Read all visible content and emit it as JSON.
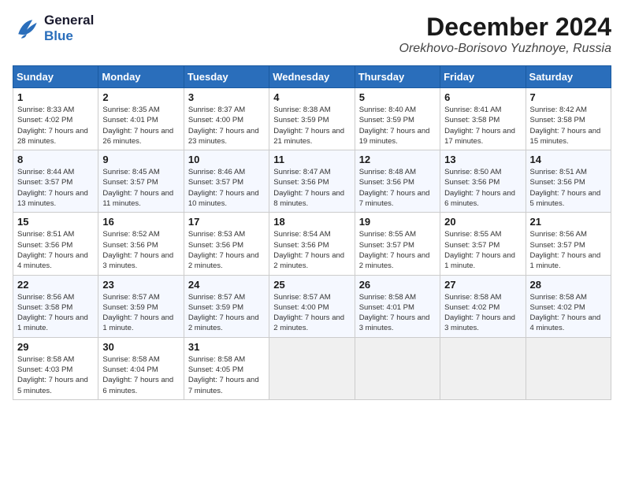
{
  "header": {
    "logo_line1": "General",
    "logo_line2": "Blue",
    "month": "December 2024",
    "location": "Orekhovo-Borisovo Yuzhnoye, Russia"
  },
  "days_of_week": [
    "Sunday",
    "Monday",
    "Tuesday",
    "Wednesday",
    "Thursday",
    "Friday",
    "Saturday"
  ],
  "weeks": [
    [
      {
        "day": 1,
        "sunrise": "8:33 AM",
        "sunset": "4:02 PM",
        "daylight": "7 hours and 28 minutes."
      },
      {
        "day": 2,
        "sunrise": "8:35 AM",
        "sunset": "4:01 PM",
        "daylight": "7 hours and 26 minutes."
      },
      {
        "day": 3,
        "sunrise": "8:37 AM",
        "sunset": "4:00 PM",
        "daylight": "7 hours and 23 minutes."
      },
      {
        "day": 4,
        "sunrise": "8:38 AM",
        "sunset": "3:59 PM",
        "daylight": "7 hours and 21 minutes."
      },
      {
        "day": 5,
        "sunrise": "8:40 AM",
        "sunset": "3:59 PM",
        "daylight": "7 hours and 19 minutes."
      },
      {
        "day": 6,
        "sunrise": "8:41 AM",
        "sunset": "3:58 PM",
        "daylight": "7 hours and 17 minutes."
      },
      {
        "day": 7,
        "sunrise": "8:42 AM",
        "sunset": "3:58 PM",
        "daylight": "7 hours and 15 minutes."
      }
    ],
    [
      {
        "day": 8,
        "sunrise": "8:44 AM",
        "sunset": "3:57 PM",
        "daylight": "7 hours and 13 minutes."
      },
      {
        "day": 9,
        "sunrise": "8:45 AM",
        "sunset": "3:57 PM",
        "daylight": "7 hours and 11 minutes."
      },
      {
        "day": 10,
        "sunrise": "8:46 AM",
        "sunset": "3:57 PM",
        "daylight": "7 hours and 10 minutes."
      },
      {
        "day": 11,
        "sunrise": "8:47 AM",
        "sunset": "3:56 PM",
        "daylight": "7 hours and 8 minutes."
      },
      {
        "day": 12,
        "sunrise": "8:48 AM",
        "sunset": "3:56 PM",
        "daylight": "7 hours and 7 minutes."
      },
      {
        "day": 13,
        "sunrise": "8:50 AM",
        "sunset": "3:56 PM",
        "daylight": "7 hours and 6 minutes."
      },
      {
        "day": 14,
        "sunrise": "8:51 AM",
        "sunset": "3:56 PM",
        "daylight": "7 hours and 5 minutes."
      }
    ],
    [
      {
        "day": 15,
        "sunrise": "8:51 AM",
        "sunset": "3:56 PM",
        "daylight": "7 hours and 4 minutes."
      },
      {
        "day": 16,
        "sunrise": "8:52 AM",
        "sunset": "3:56 PM",
        "daylight": "7 hours and 3 minutes."
      },
      {
        "day": 17,
        "sunrise": "8:53 AM",
        "sunset": "3:56 PM",
        "daylight": "7 hours and 2 minutes."
      },
      {
        "day": 18,
        "sunrise": "8:54 AM",
        "sunset": "3:56 PM",
        "daylight": "7 hours and 2 minutes."
      },
      {
        "day": 19,
        "sunrise": "8:55 AM",
        "sunset": "3:57 PM",
        "daylight": "7 hours and 2 minutes."
      },
      {
        "day": 20,
        "sunrise": "8:55 AM",
        "sunset": "3:57 PM",
        "daylight": "7 hours and 1 minute."
      },
      {
        "day": 21,
        "sunrise": "8:56 AM",
        "sunset": "3:57 PM",
        "daylight": "7 hours and 1 minute."
      }
    ],
    [
      {
        "day": 22,
        "sunrise": "8:56 AM",
        "sunset": "3:58 PM",
        "daylight": "7 hours and 1 minute."
      },
      {
        "day": 23,
        "sunrise": "8:57 AM",
        "sunset": "3:59 PM",
        "daylight": "7 hours and 1 minute."
      },
      {
        "day": 24,
        "sunrise": "8:57 AM",
        "sunset": "3:59 PM",
        "daylight": "7 hours and 2 minutes."
      },
      {
        "day": 25,
        "sunrise": "8:57 AM",
        "sunset": "4:00 PM",
        "daylight": "7 hours and 2 minutes."
      },
      {
        "day": 26,
        "sunrise": "8:58 AM",
        "sunset": "4:01 PM",
        "daylight": "7 hours and 3 minutes."
      },
      {
        "day": 27,
        "sunrise": "8:58 AM",
        "sunset": "4:02 PM",
        "daylight": "7 hours and 3 minutes."
      },
      {
        "day": 28,
        "sunrise": "8:58 AM",
        "sunset": "4:02 PM",
        "daylight": "7 hours and 4 minutes."
      }
    ],
    [
      {
        "day": 29,
        "sunrise": "8:58 AM",
        "sunset": "4:03 PM",
        "daylight": "7 hours and 5 minutes."
      },
      {
        "day": 30,
        "sunrise": "8:58 AM",
        "sunset": "4:04 PM",
        "daylight": "7 hours and 6 minutes."
      },
      {
        "day": 31,
        "sunrise": "8:58 AM",
        "sunset": "4:05 PM",
        "daylight": "7 hours and 7 minutes."
      },
      null,
      null,
      null,
      null
    ]
  ],
  "labels": {
    "sunrise_prefix": "Sunrise: ",
    "sunset_prefix": "Sunset: ",
    "daylight_prefix": "Daylight: "
  }
}
